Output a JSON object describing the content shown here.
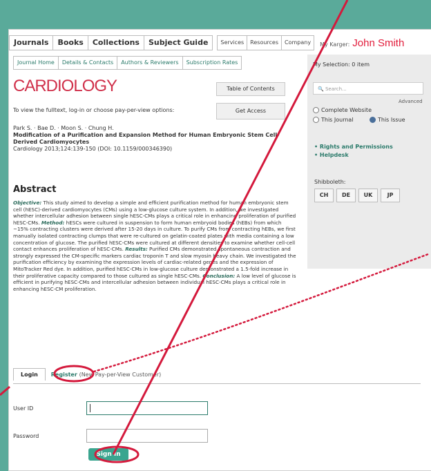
{
  "nav": {
    "main": [
      "Journals",
      "Books",
      "Collections",
      "Subject Guide"
    ],
    "secondary": [
      "Services",
      "Resources",
      "Company"
    ],
    "karger_label": "My Karger:",
    "user_name": "John Smith"
  },
  "subnav": [
    "Journal Home",
    "Details & Contacts",
    "Authors & Reviewers",
    "Subscription Rates"
  ],
  "journal": {
    "logo_text": "CARDIOLOGY",
    "toc_button": "Table of Contents",
    "fulltext_prompt": "To view the fulltext, log-in or choose pay-per-view options:",
    "get_access_button": "Get Access"
  },
  "article": {
    "authors": "Park S. · Bae D. · Moon S. · Chung H.",
    "title": "Modification of a Purification and Expansion Method for Human Embryonic Stem Cell-Derived Cardiomyocytes",
    "citation": "Cardiology 2013;124:139-150 (DOI: 10.1159/000346390)"
  },
  "abstract": {
    "heading": "Abstract",
    "objective_label": "Objective:",
    "objective": "This study aimed to develop a simple and efficient purification method for human embryonic stem cell (hESC)-derived cardiomyocytes (CMs) using a low-glucose culture system. In addition, we investigated whether intercellular adhesion between single hESC-CMs plays a critical role in enhancing proliferation of purified hESC-CMs.",
    "method_label": "Method:",
    "method": "hESCs were cultured in suspension to form human embryoid bodies (hEBs) from which ~15% contracting clusters were derived after 15-20 days in culture. To purify CMs from contracting hEBs, we first manually isolated contracting clumps that were re-cultured on gelatin-coated plates with media containing a low concentration of glucose. The purified hESC-CMs were cultured at different densities to examine whether cell-cell contact enhances proliferation of hESC-CMs.",
    "results_label": "Results:",
    "results": "Purified CMs demonstrated spontaneous contraction and strongly expressed the CM-specific markers cardiac troponin T and slow myosin heavy chain. We investigated the purification efficiency by examining the expression levels of cardiac-related genes and the expression of MitoTracker Red dye. In addition, purified hESC-CMs in low-glucose culture demonstrated a 1.5-fold increase in their proliferative capacity compared to those cultured as single hESC-CMs.",
    "conclusion_label": "Conclusion:",
    "conclusion": "A low level of glucose is efficient in purifying hESC-CMs and intercellular adhesion between individual hESC-CMs plays a critical role in enhancing hESC-CM proliferation."
  },
  "sidebar": {
    "selection": "My Selection: 0 item",
    "search_placeholder": "Search...",
    "advanced": "Advanced",
    "scope_options": [
      "Complete Website",
      "This Journal",
      "This Issue"
    ],
    "links": [
      "Rights and Permissions",
      "Helpdesk"
    ],
    "shibboleth_label": "Shibboleth:",
    "shibboleth_buttons": [
      "CH",
      "DE",
      "UK",
      "JP"
    ]
  },
  "login": {
    "tab_login": "Login",
    "tab_register": "Register",
    "tab_register_note": "(New Pay-per-View Customer)",
    "user_id_label": "User ID",
    "password_label": "Password",
    "sign_in_button": "Sign In"
  },
  "colors": {
    "accent": "#5aaa9a",
    "annotation": "#d4193c",
    "link": "#2a7a6a"
  }
}
